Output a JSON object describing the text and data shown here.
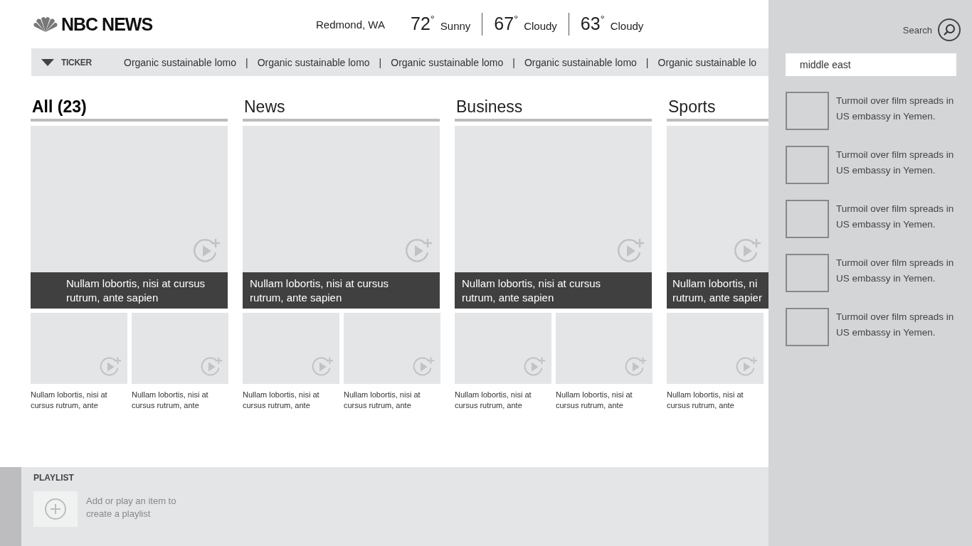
{
  "header": {
    "logo": "NBC NEWS",
    "location": "Redmond, WA",
    "forecast": [
      {
        "temp": "72",
        "unit": "°",
        "condition": "Sunny"
      },
      {
        "temp": "67",
        "unit": "°",
        "condition": "Cloudy"
      },
      {
        "temp": "63",
        "unit": "°",
        "condition": "Cloudy"
      }
    ]
  },
  "ticker": {
    "label": "TICKER",
    "expanded": true,
    "separator": "|",
    "items": [
      "Organic sustainable lomo",
      "Organic sustainable lomo",
      "Organic sustainable lomo",
      "Organic sustainable lomo",
      "Organic sustainable lo"
    ]
  },
  "sections": [
    {
      "title": "All (23)",
      "selected": true,
      "featured": {
        "title": "Nullam lobortis, nisi at cursus\nrutrum, ante sapien"
      },
      "stories": [
        {
          "title": "Nullam lobortis, nisi at cursus rutrum, ante"
        },
        {
          "title": "Nullam lobortis, nisi at cursus rutrum, ante"
        }
      ]
    },
    {
      "title": "News",
      "selected": false,
      "featured": {
        "title": "Nullam lobortis, nisi at cursus\nrutrum, ante sapien"
      },
      "stories": [
        {
          "title": "Nullam lobortis, nisi at cursus rutrum, ante"
        },
        {
          "title": "Nullam lobortis, nisi at cursus rutrum, ante"
        }
      ]
    },
    {
      "title": "Business",
      "selected": false,
      "featured": {
        "title": "Nullam lobortis, nisi at cursus\nrutrum, ante sapien"
      },
      "stories": [
        {
          "title": "Nullam lobortis, nisi at cursus rutrum, ante"
        },
        {
          "title": "Nullam lobortis, nisi at cursus rutrum, ante"
        }
      ]
    },
    {
      "title": "Sports",
      "selected": false,
      "featured": {
        "title": "Nullam lobortis, ni\nrutrum, ante sapier"
      },
      "stories": [
        {
          "title": "Nullam lobortis, nisi at cursus rutrum, ante"
        }
      ]
    }
  ],
  "playlist": {
    "title": "PLAYLIST",
    "hint": "Add or play an item to create a playlist"
  },
  "search_pane": {
    "label": "Search",
    "value": "middle east",
    "results": [
      {
        "title": "Turmoil over film spreads in US embassy in Yemen."
      },
      {
        "title": "Turmoil over film spreads in US embassy in Yemen."
      },
      {
        "title": "Turmoil over film spreads in US embassy in Yemen."
      },
      {
        "title": "Turmoil over film spreads in US embassy in Yemen."
      },
      {
        "title": "Turmoil over film spreads in US embassy in Yemen."
      }
    ]
  }
}
